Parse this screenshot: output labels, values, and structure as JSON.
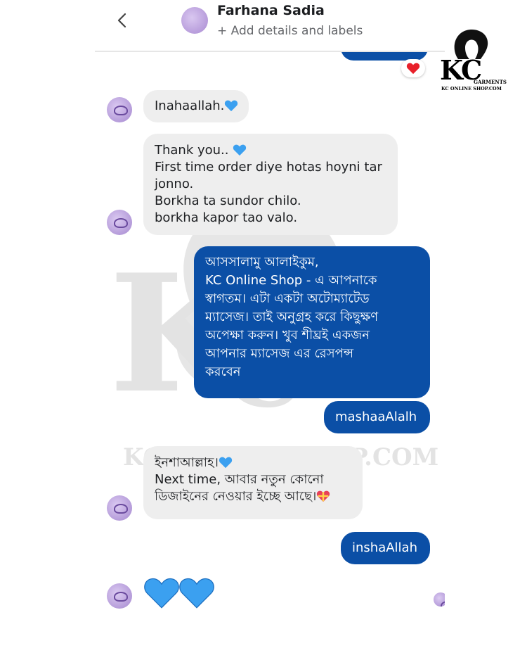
{
  "header": {
    "contact_name": "Farhana Sadia",
    "subtitle": "+ Add details and labels"
  },
  "logo": {
    "brand": "KC",
    "tagline": "GARMENTS",
    "site": "KC ONLINE SHOP.COM"
  },
  "messages": [
    {
      "from": "contact",
      "lines": [
        "Inahaallah."
      ]
    },
    {
      "from": "contact",
      "lines": [
        "Thank you..",
        "First time order diye hotas hoyni tar",
        "jonno.",
        "Borkha ta sundor chilo.",
        "borkha kapor tao valo."
      ]
    },
    {
      "from": "me",
      "lines": [
        "আসসালামু আলাইকুম,",
        "KC Online Shop - এ আপনাকে",
        "স্বাগতম। এটা একটা অটোম্যাটেড",
        "ম্যাসেজ। তাই অনুগ্রহ করে কিছুক্ষণ",
        "অপেক্ষা করুন। খুব শীঘ্রই একজন",
        "আপনার ম্যাসেজ এর রেসপন্স",
        "করবেন"
      ]
    },
    {
      "from": "me",
      "lines": [
        "mashaaAlalh"
      ]
    },
    {
      "from": "contact",
      "lines": [
        "ইনশাআল্লাহ।",
        "Next time, আবার নতুন কোনো",
        "ডিজাইনের নেওয়ার ইচ্ছে আছে।"
      ]
    },
    {
      "from": "me",
      "lines": [
        "inshaAllah"
      ]
    }
  ],
  "colors": {
    "outgoing_bubble": "#0b4fa6",
    "incoming_bubble": "#eeeeee",
    "heart_blue": "#3ba0f0",
    "heart_red": "#e8202a"
  },
  "icons": [
    "back-chevron-icon",
    "blue-heart-icon",
    "red-heart-icon",
    "gift-heart-icon"
  ]
}
